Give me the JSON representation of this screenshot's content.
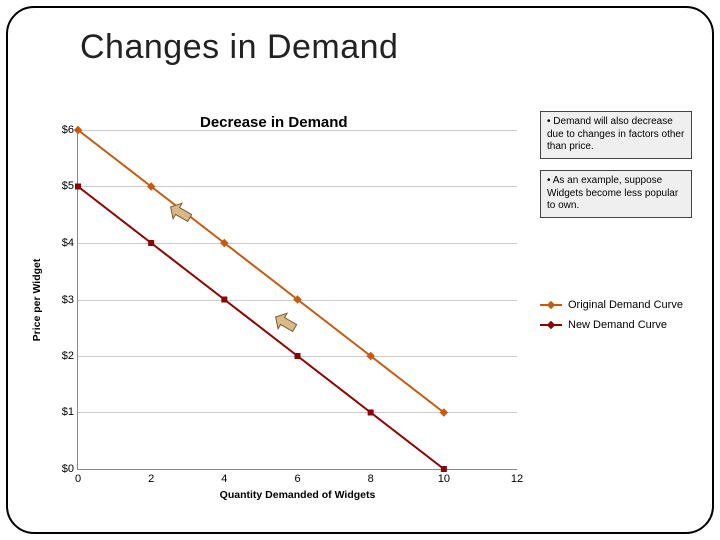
{
  "title": "Changes in Demand",
  "subtitle": "Decrease in Demand",
  "notes": {
    "n1": "• Demand will also decrease due to changes in factors other than price.",
    "n2": "• As an example, suppose Widgets become less popular to own."
  },
  "legend": {
    "orig": "Original Demand Curve",
    "new_": "New Demand Curve"
  },
  "axes": {
    "ylabel": "Price per Widget",
    "xlabel": "Quantity Demanded of Widgets",
    "yticks": [
      "$0",
      "$1",
      "$2",
      "$3",
      "$4",
      "$5",
      "$6"
    ],
    "xticks": [
      "0",
      "2",
      "4",
      "6",
      "8",
      "10",
      "12"
    ]
  },
  "chart_data": {
    "type": "line",
    "title": "Decrease in Demand",
    "xlabel": "Quantity Demanded of Widgets",
    "ylabel": "Price per Widget",
    "xlim": [
      0,
      12
    ],
    "ylim": [
      0,
      6
    ],
    "x": [
      0,
      2,
      4,
      6,
      8,
      10
    ],
    "series": [
      {
        "name": "Original Demand Curve",
        "color": "#c55a11",
        "values": [
          6,
          5,
          4,
          3,
          2,
          1
        ]
      },
      {
        "name": "New Demand Curve",
        "color": "#8b0000",
        "values": [
          5,
          4,
          3,
          2,
          1,
          0
        ]
      }
    ],
    "annotations": [
      {
        "type": "arrow",
        "from": [
          3,
          4.5
        ],
        "to": [
          2,
          4
        ],
        "note": "shift left/down"
      },
      {
        "type": "arrow",
        "from": [
          6,
          3
        ],
        "to": [
          5,
          2.5
        ],
        "note": "shift left/down"
      }
    ]
  }
}
